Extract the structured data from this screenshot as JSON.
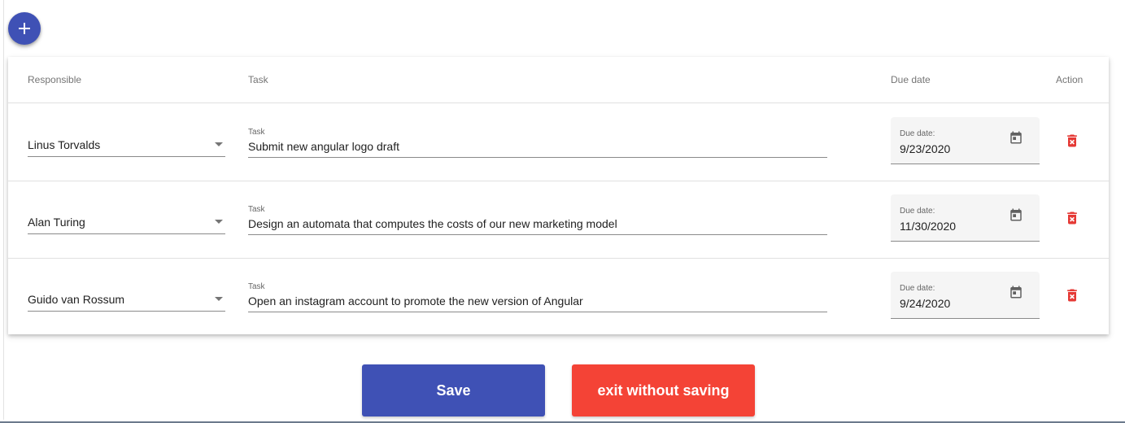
{
  "colors": {
    "primary": "#3f51b5",
    "warn": "#f44336",
    "delete_icon": "#e53935",
    "date_bg": "#f5f5f5"
  },
  "toolbar": {
    "add_icon": "plus-icon"
  },
  "table": {
    "headers": {
      "responsible": "Responsible",
      "task": "Task",
      "due_date": "Due date",
      "action": "Action"
    },
    "rows": [
      {
        "responsible": "Linus Torvalds",
        "task_label": "Task",
        "task": "Submit new angular logo draft",
        "due_label": "Due date:",
        "due_date": "9/23/2020"
      },
      {
        "responsible": "Alan Turing",
        "task_label": "Task",
        "task": "Design an automata that computes the costs of our new marketing model",
        "due_label": "Due date:",
        "due_date": "11/30/2020"
      },
      {
        "responsible": "Guido van Rossum",
        "task_label": "Task",
        "task": "Open an instagram account to promote the new version of Angular",
        "due_label": "Due date:",
        "due_date": "9/24/2020"
      }
    ]
  },
  "actions": {
    "save_label": "Save",
    "exit_label": "exit without saving"
  }
}
